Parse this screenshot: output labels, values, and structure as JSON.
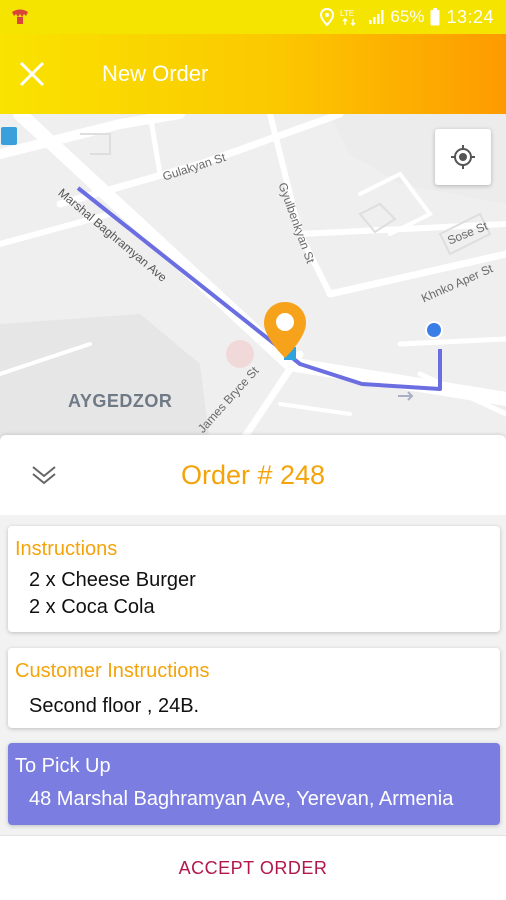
{
  "status_bar": {
    "battery": "65%",
    "time": "13:24",
    "network": "LTE",
    "icons": [
      "app-notification-icon",
      "location-icon",
      "lte-icon",
      "signal-icon",
      "battery-icon"
    ]
  },
  "app_bar": {
    "title": "New Order",
    "close_icon": "close-icon"
  },
  "map": {
    "street_labels": [
      "Gulakyan St",
      "Gyulbenkyan St",
      "Marshal Baghramyan Ave",
      "Sose St",
      "Khnko Aper St",
      "James Bryce St"
    ],
    "area_label": "AYGEDZOR",
    "locate_icon": "my-location-icon",
    "route_color": "#6b6ee0",
    "pin_color": "#f7a21b"
  },
  "order": {
    "title": "Order # 248",
    "collapse_icon": "double-chevron-down-icon"
  },
  "instructions": {
    "title": "Instructions",
    "items": [
      "2 x Cheese Burger",
      "2 x Coca Cola"
    ]
  },
  "customer_instructions": {
    "title": "Customer Instructions",
    "text": "Second floor , 24B."
  },
  "pickup": {
    "title": "To Pick Up",
    "address": "48 Marshal Baghramyan Ave, Yerevan, Armenia"
  },
  "actions": {
    "accept_label": "ACCEPT ORDER"
  },
  "colors": {
    "accent": "#f4a40a",
    "app_bar_start": "#f9e300",
    "app_bar_end": "#fe9a00",
    "pickup_card": "#7b7ee0",
    "accept_text": "#b2174b"
  }
}
